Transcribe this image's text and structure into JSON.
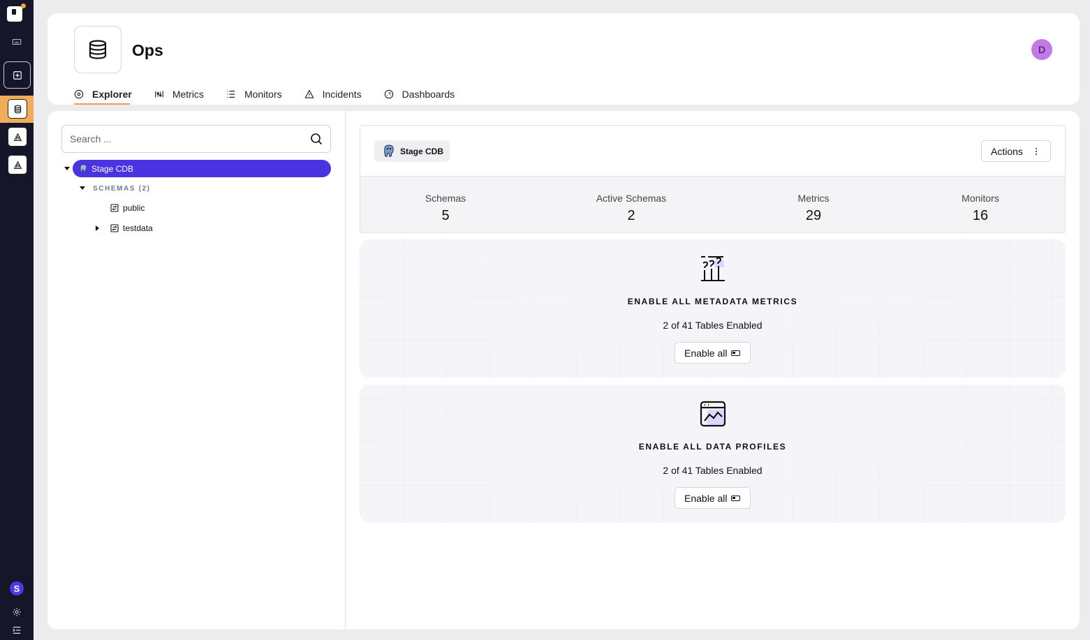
{
  "rail": {
    "badge_letter": "S"
  },
  "header": {
    "title": "Ops",
    "avatar_initial": "D",
    "tabs": [
      {
        "label": "Explorer",
        "icon": "compass-icon",
        "active": true
      },
      {
        "label": "Metrics",
        "icon": "metrics-icon",
        "active": false
      },
      {
        "label": "Monitors",
        "icon": "list-icon",
        "active": false
      },
      {
        "label": "Incidents",
        "icon": "warning-icon",
        "active": false
      },
      {
        "label": "Dashboards",
        "icon": "gauge-icon",
        "active": false
      }
    ]
  },
  "sidebar": {
    "search_placeholder": "Search ...",
    "root_label": "Stage CDB",
    "schemas_label": "SCHEMAS (2)",
    "schemas": [
      {
        "label": "public"
      },
      {
        "label": "testdata"
      }
    ]
  },
  "datasource": {
    "chip_label": "Stage CDB",
    "actions_label": "Actions",
    "stats": [
      {
        "label": "Schemas",
        "value": "5"
      },
      {
        "label": "Active Schemas",
        "value": "2"
      },
      {
        "label": "Metrics",
        "value": "29"
      },
      {
        "label": "Monitors",
        "value": "16"
      }
    ]
  },
  "features": [
    {
      "title": "ENABLE ALL METADATA METRICS",
      "subtitle": "2 of 41 Tables Enabled",
      "button_label": "Enable all"
    },
    {
      "title": "ENABLE ALL DATA PROFILES",
      "subtitle": "2 of 41 Tables Enabled",
      "button_label": "Enable all"
    }
  ],
  "colors": {
    "accent": "#4a33e0",
    "tab_underline": "#e8a04b",
    "rail": "#16162a",
    "avatar": "#c27ae6"
  }
}
